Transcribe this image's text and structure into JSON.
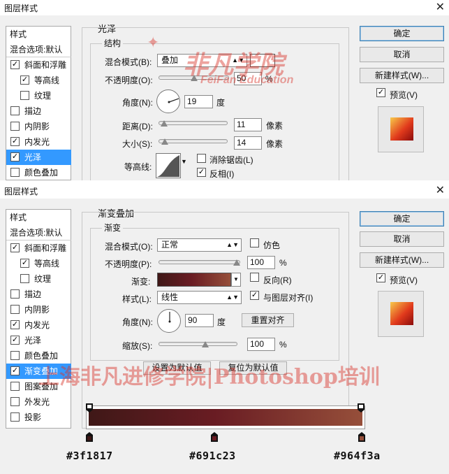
{
  "dialog1": {
    "title": "图层样式",
    "left_items": [
      {
        "label": "样式",
        "kind": "header"
      },
      {
        "label": "混合选项:默认",
        "kind": "header2"
      },
      {
        "label": "斜面和浮雕",
        "checked": true,
        "indent": false
      },
      {
        "label": "等高线",
        "checked": true,
        "indent": true
      },
      {
        "label": "纹理",
        "checked": false,
        "indent": true
      },
      {
        "label": "描边",
        "checked": false,
        "indent": false
      },
      {
        "label": "内阴影",
        "checked": false,
        "indent": false
      },
      {
        "label": "内发光",
        "checked": true,
        "indent": false
      },
      {
        "label": "光泽",
        "checked": true,
        "indent": false,
        "selected": true
      },
      {
        "label": "颜色叠加",
        "checked": false,
        "indent": false
      }
    ],
    "section_title": "光泽",
    "group_title": "结构",
    "blend_mode_label": "混合模式(B):",
    "blend_mode_value": "叠加",
    "opacity_label": "不透明度(O):",
    "opacity_value": "50",
    "opacity_unit": "%",
    "opacity_level": 0.5,
    "angle_label": "角度(N):",
    "angle_value": "19",
    "angle_unit": "度",
    "distance_label": "距离(D):",
    "distance_value": "11",
    "distance_unit": "像素",
    "size_label": "大小(S):",
    "size_value": "14",
    "size_unit": "像素",
    "contour_label": "等高线:",
    "antialias_label": "消除锯齿(L)",
    "antialias_checked": false,
    "invert_label": "反相(I)",
    "invert_checked": true,
    "buttons": {
      "ok": "确定",
      "cancel": "取消",
      "new_style": "新建样式(W)...",
      "preview": "预览(V)"
    },
    "preview_checked": true
  },
  "dialog2": {
    "title": "图层样式",
    "left_items": [
      {
        "label": "样式",
        "kind": "header"
      },
      {
        "label": "混合选项:默认",
        "kind": "header2"
      },
      {
        "label": "斜面和浮雕",
        "checked": true,
        "indent": false
      },
      {
        "label": "等高线",
        "checked": true,
        "indent": true
      },
      {
        "label": "纹理",
        "checked": false,
        "indent": true
      },
      {
        "label": "描边",
        "checked": false,
        "indent": false
      },
      {
        "label": "内阴影",
        "checked": false,
        "indent": false
      },
      {
        "label": "内发光",
        "checked": true,
        "indent": false
      },
      {
        "label": "光泽",
        "checked": true,
        "indent": false
      },
      {
        "label": "颜色叠加",
        "checked": false,
        "indent": false
      },
      {
        "label": "渐变叠加",
        "checked": true,
        "indent": false,
        "selected": true
      },
      {
        "label": "图案叠加",
        "checked": false,
        "indent": false
      },
      {
        "label": "外发光",
        "checked": false,
        "indent": false
      },
      {
        "label": "投影",
        "checked": false,
        "indent": false
      }
    ],
    "section_title": "渐变叠加",
    "group_title": "渐变",
    "blend_mode_label": "混合模式(O):",
    "blend_mode_value": "正常",
    "dither_label": "仿色",
    "dither_checked": false,
    "opacity_label": "不透明度(P):",
    "opacity_value": "100",
    "opacity_unit": "%",
    "opacity_level": 1.0,
    "gradient_label": "渐变:",
    "reverse_label": "反向(R)",
    "reverse_checked": false,
    "style_label": "样式(L):",
    "style_value": "线性",
    "align_label": "与图层对齐(I)",
    "align_checked": true,
    "angle_label": "角度(N):",
    "angle_value": "90",
    "angle_unit": "度",
    "reset_align": "重置对齐",
    "scale_label": "缩放(S):",
    "scale_value": "100",
    "scale_unit": "%",
    "scale_level": 0.6,
    "set_default": "设置为默认值",
    "reset_default": "复位为默认值",
    "buttons": {
      "ok": "确定",
      "cancel": "取消",
      "new_style": "新建样式(W)...",
      "preview": "预览(V)"
    },
    "preview_checked": true,
    "gradient_stops": [
      {
        "hex": "#3f1817",
        "position": 0
      },
      {
        "hex": "#691c23",
        "position": 0.46
      },
      {
        "hex": "#964f3a",
        "position": 1
      }
    ]
  },
  "watermarks": {
    "logo_cn": "非凡学院",
    "logo_en": "FeiFan Education",
    "banner": "上海非凡进修学院|Photoshop培训"
  },
  "colors": {
    "selection": "#3399ff",
    "gradient_start": "#3f1817",
    "gradient_mid": "#691c23",
    "gradient_end": "#964f3a"
  }
}
